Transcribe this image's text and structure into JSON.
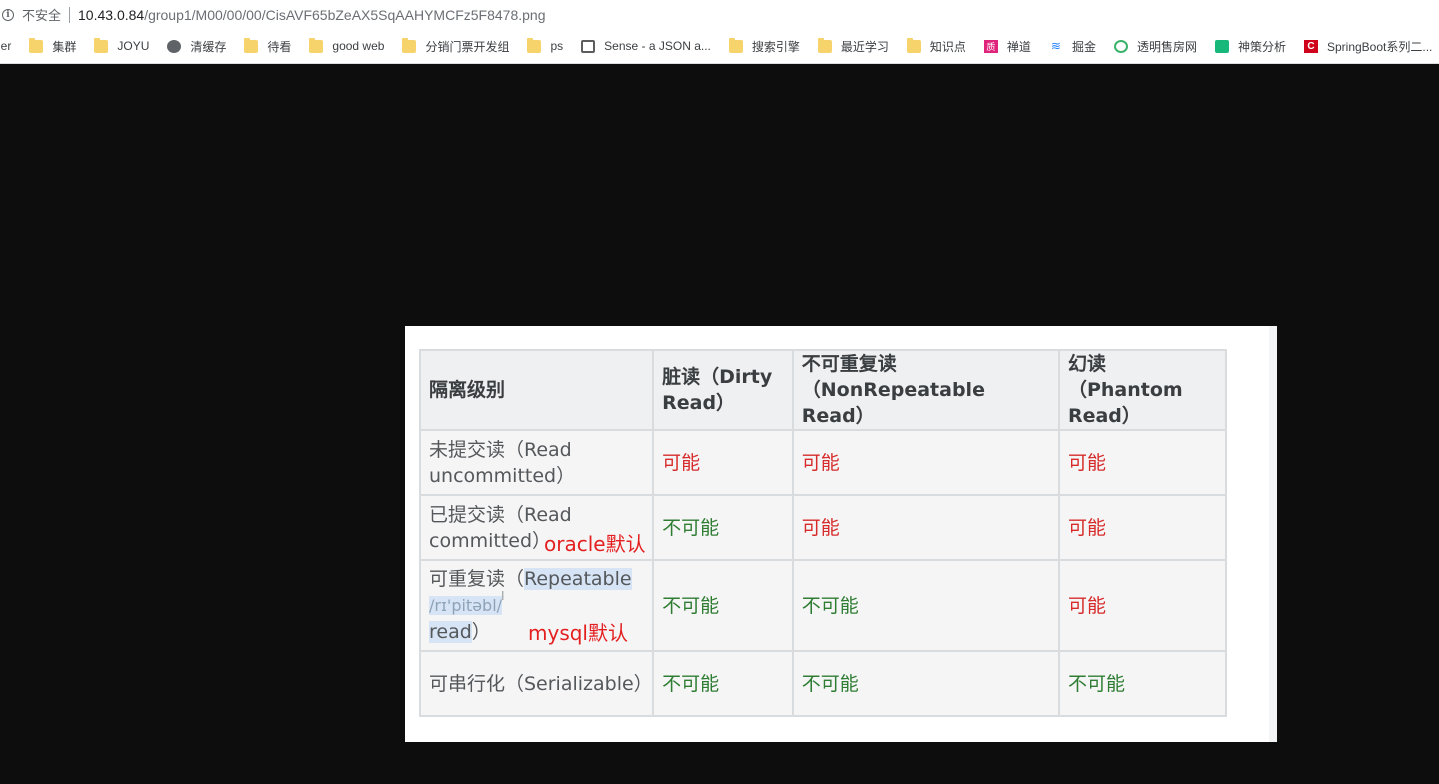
{
  "address_bar": {
    "security_label": "不安全",
    "url_host": "10.43.0.84",
    "url_path": "/group1/M00/00/00/CisAVF65bZeAX5SqAAHYMCFz5F8478.png"
  },
  "bookmarks": [
    {
      "label": "ner",
      "icon": "none"
    },
    {
      "label": "集群",
      "icon": "folder-icon"
    },
    {
      "label": "JOYU",
      "icon": "folder-icon"
    },
    {
      "label": "清缓存",
      "icon": "globe-icon"
    },
    {
      "label": "待看",
      "icon": "folder-icon"
    },
    {
      "label": "good web",
      "icon": "folder-icon"
    },
    {
      "label": "分销门票开发组",
      "icon": "folder-icon"
    },
    {
      "label": "ps",
      "icon": "folder-icon"
    },
    {
      "label": "Sense - a JSON a...",
      "icon": "sense-icon"
    },
    {
      "label": "搜索引擎",
      "icon": "folder-icon"
    },
    {
      "label": "最近学习",
      "icon": "folder-icon"
    },
    {
      "label": "知识点",
      "icon": "folder-icon"
    },
    {
      "label": "禅道",
      "icon": "zentao-icon"
    },
    {
      "label": "掘金",
      "icon": "juejin-icon"
    },
    {
      "label": "透明售房网",
      "icon": "tmsf-icon"
    },
    {
      "label": "神策分析",
      "icon": "shence-icon"
    },
    {
      "label": "SpringBoot系列二...",
      "icon": "springboot-icon"
    }
  ],
  "table": {
    "headers": [
      "隔离级别",
      "脏读（Dirty Read）",
      "不可重复读（NonRepeatable Read）",
      "幻读（Phantom Read）"
    ],
    "rows": [
      {
        "level": "未提交读（Read uncommitted）",
        "dirty": "可能",
        "nonrepeat": "可能",
        "phantom": "可能"
      },
      {
        "level": "已提交读（Read committed）",
        "dirty": "不可能",
        "nonrepeat": "可能",
        "phantom": "可能"
      },
      {
        "level_prefix": "可重复读（",
        "level_highlight": "Repeatable",
        "phonetic": "/rɪ'pitəbl/",
        "level_tail_highlight": "read",
        "level_suffix": "）",
        "dirty": "不可能",
        "nonrepeat": "不可能",
        "phantom": "可能"
      },
      {
        "level": "可串行化（Serializable）",
        "dirty": "不可能",
        "nonrepeat": "不可能",
        "phantom": "不可能"
      }
    ],
    "notes": {
      "oracle": "oracle默认",
      "mysql": "mysql默认"
    }
  },
  "colors": {
    "possible": "#d72b2b",
    "impossible": "#2e7d32",
    "annotation": "#e41f1f",
    "background": "#0e0d0d"
  }
}
